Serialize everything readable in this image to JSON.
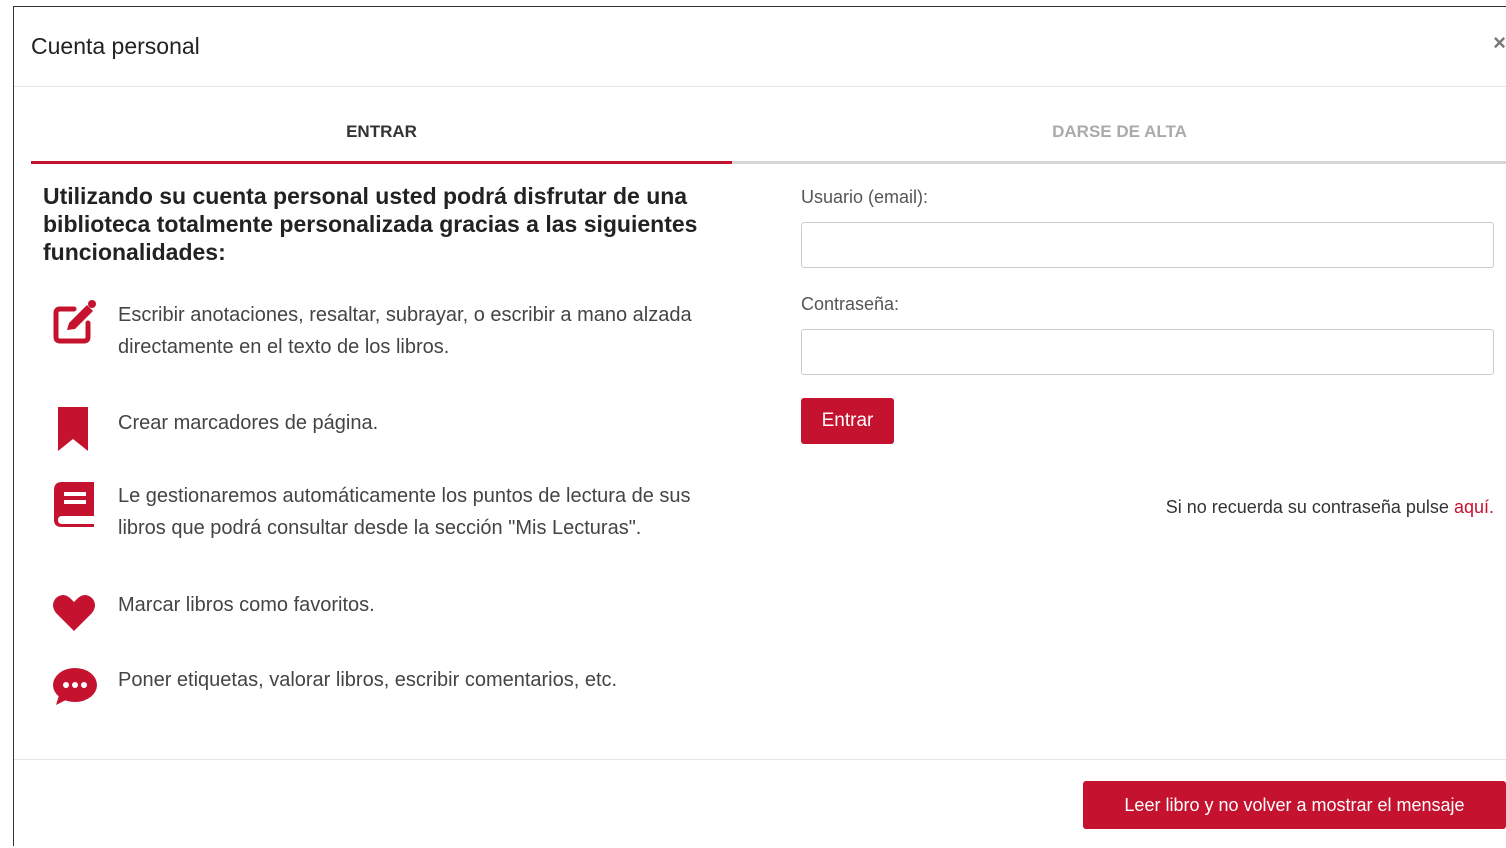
{
  "modal": {
    "title": "Cuenta personal",
    "close_label": "×"
  },
  "tabs": [
    {
      "label": "ENTRAR",
      "active": true
    },
    {
      "label": "DARSE DE ALTA",
      "active": false
    }
  ],
  "intro": "Utilizando su cuenta personal usted podrá disfrutar de una biblioteca totalmente personalizada gracias a las siguientes funcionalidades:",
  "features": [
    {
      "icon": "edit-icon",
      "text": "Escribir anotaciones, resaltar, subrayar, o escribir a mano alzada directamente en el texto de los libros."
    },
    {
      "icon": "bookmark-icon",
      "text": "Crear marcadores de página."
    },
    {
      "icon": "book-icon",
      "text": "Le gestionaremos automáticamente los puntos de lectura de sus libros que podrá consultar desde la sección \"Mis Lecturas\"."
    },
    {
      "icon": "heart-icon",
      "text": "Marcar libros como favoritos."
    },
    {
      "icon": "comment-icon",
      "text": "Poner etiquetas, valorar libros, escribir comentarios, etc."
    }
  ],
  "form": {
    "user_label": "Usuario (email):",
    "user_value": "",
    "password_label": "Contraseña:",
    "password_value": "",
    "submit_label": "Entrar",
    "forgot_text": "Si no recuerda su contraseña pulse ",
    "forgot_link": "aquí."
  },
  "footer": {
    "read_button_label": "Leer libro y no volver a mostrar el mensaje"
  },
  "colors": {
    "accent": "#c4122f"
  }
}
